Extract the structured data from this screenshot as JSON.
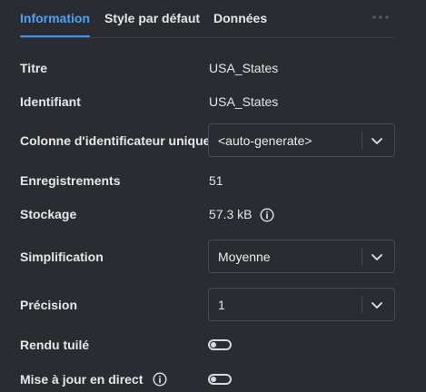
{
  "tabs": [
    {
      "label": "Information",
      "active": true
    },
    {
      "label": "Style par défaut",
      "active": false
    },
    {
      "label": "Données",
      "active": false
    }
  ],
  "more_icon": "more-horizontal-icon",
  "fields": {
    "titre": {
      "label": "Titre",
      "value": "USA_States"
    },
    "identifiant": {
      "label": "Identifiant",
      "value": "USA_States"
    },
    "colonne_id": {
      "label": "Colonne d'identificateur unique",
      "selected": "<auto-generate>"
    },
    "enregistrements": {
      "label": "Enregistrements",
      "value": "51"
    },
    "stockage": {
      "label": "Stockage",
      "value": "57.3 kB",
      "icon": "info-icon"
    },
    "simplification": {
      "label": "Simplification",
      "selected": "Moyenne"
    },
    "precision": {
      "label": "Précision",
      "selected": "1"
    },
    "rendu_tuile": {
      "label": "Rendu tuilé",
      "enabled": false
    },
    "mise_a_jour": {
      "label": "Mise à jour en direct",
      "icon": "info-icon",
      "enabled": false
    }
  },
  "colors": {
    "background": "#2b2c31",
    "accent": "#4aa3ff",
    "text": "#e6e7ea",
    "border": "#4a4b52"
  }
}
